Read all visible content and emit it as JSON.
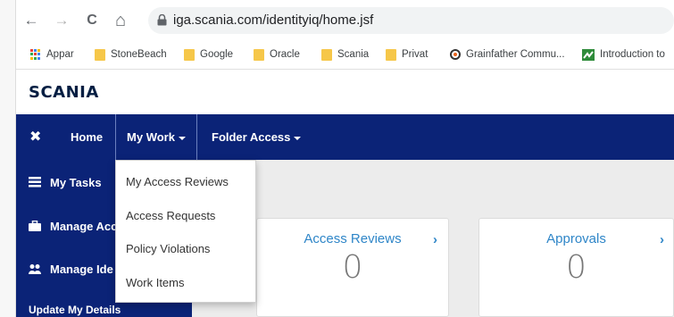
{
  "browser": {
    "url": "iga.scania.com/identityiq/home.jsf",
    "back_glyph": "←",
    "forward_glyph": "→",
    "reload_glyph": "C",
    "home_glyph": "⌂",
    "bookmarks": [
      {
        "label": "Appar",
        "icon": "apps-grid-icon"
      },
      {
        "label": "StoneBeach",
        "icon": "folder-icon"
      },
      {
        "label": "Google",
        "icon": "folder-icon"
      },
      {
        "label": "Oracle",
        "icon": "folder-icon"
      },
      {
        "label": "Scania",
        "icon": "folder-icon"
      },
      {
        "label": "Privat",
        "icon": "folder-icon"
      },
      {
        "label": "Grainfather Commu...",
        "icon": "grainfather-favicon"
      },
      {
        "label": "Introduction to",
        "icon": "green-favicon"
      }
    ]
  },
  "brand": {
    "logo_text": "SCANIA",
    "color": "#041e42"
  },
  "nav": {
    "close_glyph": "✖",
    "home": "Home",
    "my_work": "My Work",
    "folder_access": "Folder Access",
    "background": "#0b2377"
  },
  "sidebar": {
    "items": [
      {
        "label": "My Tasks",
        "icon": "tasks-icon"
      },
      {
        "label": "Manage Acc",
        "icon": "briefcase-icon"
      },
      {
        "label": "Manage Ide",
        "icon": "users-icon"
      },
      {
        "label": "Update My Details",
        "icon": ""
      }
    ]
  },
  "dropdown": {
    "items": [
      "My Access Reviews",
      "Access Requests",
      "Policy Violations",
      "Work Items"
    ]
  },
  "cards": [
    {
      "title": "Access Reviews",
      "count": "0",
      "arrow": "›"
    },
    {
      "title": "Approvals",
      "count": "0",
      "arrow": "›"
    }
  ],
  "colors": {
    "link_blue": "#2f86c8",
    "folder_yellow": "#f6c749"
  }
}
